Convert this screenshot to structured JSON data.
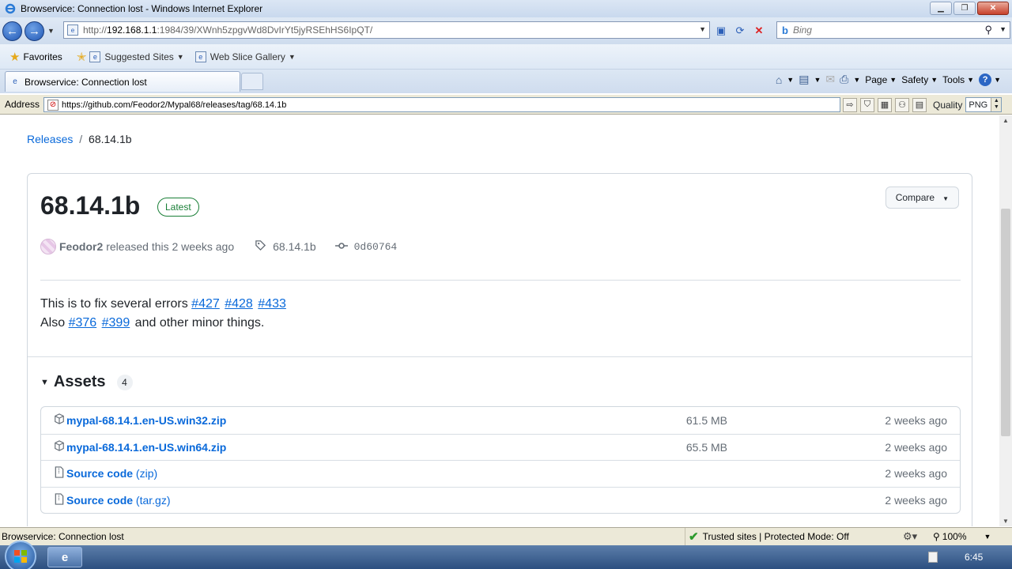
{
  "window": {
    "title": "Browservice: Connection lost - Windows Internet Explorer"
  },
  "nav": {
    "url_prefix": "http://",
    "url_host": "192.168.1.1",
    "url_rest": ":1984/39/XWnh5zpgvWd8DvIrYt5jyRSEhHS6IpQT/",
    "search_placeholder": "Bing"
  },
  "favorites": {
    "favorites_label": "Favorites",
    "suggested_sites": "Suggested Sites",
    "web_slice_gallery": "Web Slice Gallery"
  },
  "tabs": {
    "active_tab": "Browservice: Connection lost"
  },
  "commandbar": {
    "page": "Page",
    "safety": "Safety",
    "tools": "Tools"
  },
  "addressbar": {
    "label": "Address",
    "url": "https://github.com/Feodor2/Mypal68/releases/tag/68.14.1b",
    "quality_label": "Quality",
    "quality_value": "PNG"
  },
  "page": {
    "breadcrumb": {
      "releases": "Releases",
      "separator": "/",
      "current": "68.14.1b"
    },
    "release": {
      "title": "68.14.1b",
      "badge": "Latest",
      "compare_label": "Compare",
      "author": "Feodor2",
      "released_text": "released this 2 weeks ago",
      "tag": "68.14.1b",
      "commit": "0d60764"
    },
    "body": {
      "line1_text": "This is to fix several errors",
      "line1_links": [
        "#427",
        "#428",
        "#433"
      ],
      "line2_prefix": "Also",
      "line2_links": [
        "#376",
        "#399"
      ],
      "line2_suffix": "and other minor things."
    },
    "assets": {
      "title": "Assets",
      "count": "4",
      "rows": [
        {
          "name": "mypal-68.14.1.en-US.win32.zip",
          "suffix": "",
          "size": "61.5 MB",
          "date": "2 weeks ago",
          "icon": "package-icon"
        },
        {
          "name": "mypal-68.14.1.en-US.win64.zip",
          "suffix": "",
          "size": "65.5 MB",
          "date": "2 weeks ago",
          "icon": "package-icon"
        },
        {
          "name": "Source code",
          "suffix": "(zip)",
          "size": "",
          "date": "2 weeks ago",
          "icon": "file-zip-icon"
        },
        {
          "name": "Source code",
          "suffix": "(tar.gz)",
          "size": "",
          "date": "2 weeks ago",
          "icon": "file-zip-icon"
        }
      ]
    }
  },
  "statusbar": {
    "message": "Browservice: Connection lost",
    "zone": "Trusted sites | Protected Mode: Off",
    "zoom": "100%"
  },
  "taskbar": {
    "clock": "6:45"
  }
}
